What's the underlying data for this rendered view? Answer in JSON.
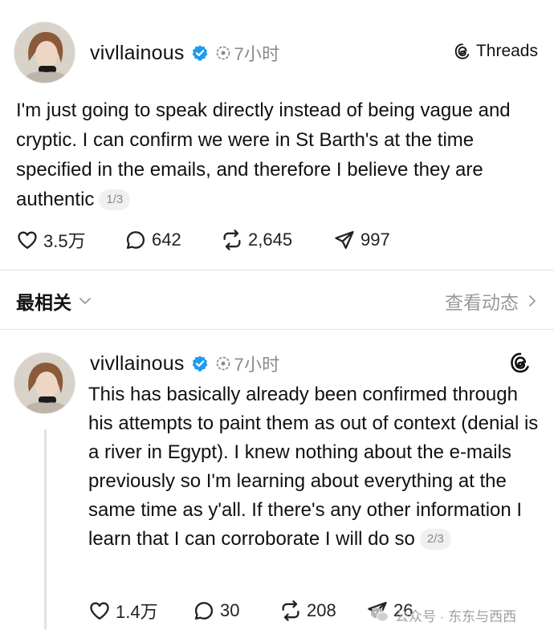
{
  "post1": {
    "username": "vivllainous",
    "time": "7小时",
    "brand": "Threads",
    "text": "I'm just going to speak directly instead of being vague and cryptic. I can confirm we were in St Barth's at the time specified in the emails, and therefore I believe they are authentic",
    "page": "1/3",
    "likes": "3.5万",
    "replies": "642",
    "reposts": "2,645",
    "shares": "997"
  },
  "sort": {
    "label": "最相关",
    "activity": "查看动态"
  },
  "post2": {
    "username": "vivllainous",
    "time": "7小时",
    "text": "This has basically already been confirmed through his attempts to paint them as out of context (denial is a river in Egypt). I knew nothing about the e-mails previously so I'm learning about everything at the same time as y'all. If there's any other information I learn that I can corroborate I will do so",
    "page": "2/3",
    "likes": "1.4万",
    "replies": "30",
    "reposts": "208",
    "shares": "26"
  },
  "watermark": {
    "text": "公众号 · 东东与西西"
  },
  "colors": {
    "verified": "#1d9bf0",
    "muted": "#8a8a8a",
    "divider": "#e3e3e3"
  },
  "icons": [
    "verified-icon",
    "clock-icon",
    "threads-logo-icon",
    "heart-icon",
    "comment-icon",
    "repost-icon",
    "share-icon",
    "chevron-down-icon",
    "chevron-right-icon",
    "wechat-icon"
  ]
}
